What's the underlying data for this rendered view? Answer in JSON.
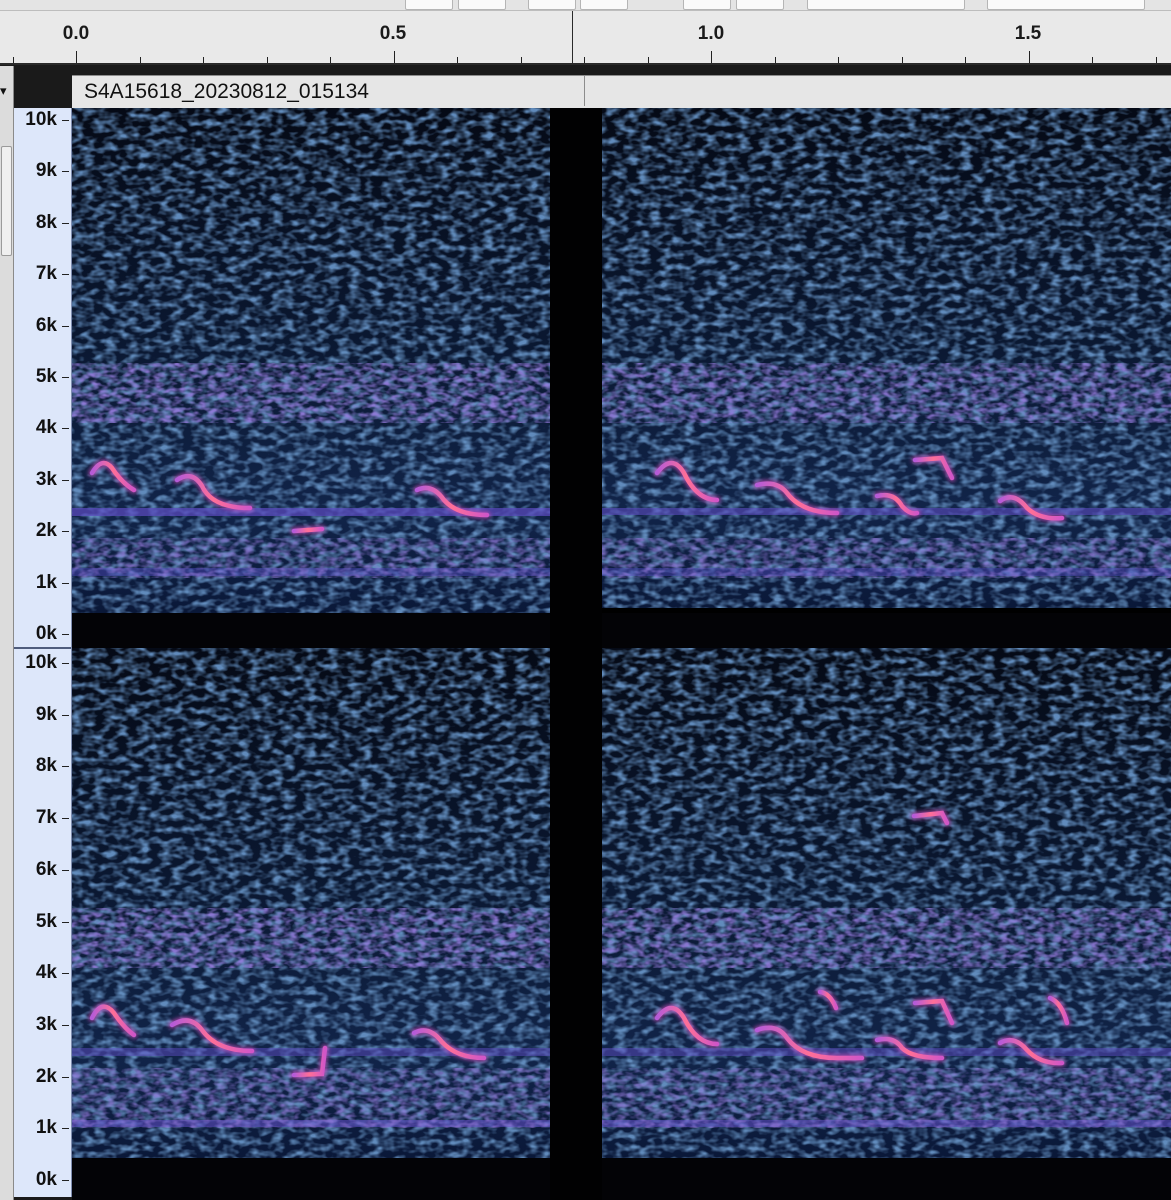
{
  "timeline": {
    "ticks": [
      {
        "label": "0.0",
        "value": 0.0
      },
      {
        "label": "0.5",
        "value": 0.5
      },
      {
        "label": "1.0",
        "value": 1.0
      },
      {
        "label": "1.5",
        "value": 1.5
      }
    ]
  },
  "track": {
    "name": "S4A15618_20230812_015134",
    "menu_arrow": "▾"
  },
  "freq_axis": {
    "labels": [
      "10k",
      "9k",
      "8k",
      "7k",
      "6k",
      "5k",
      "4k",
      "3k",
      "2k",
      "1k",
      "0k"
    ]
  },
  "colors": {
    "ruler_bg": "#e9e9e9",
    "freq_ruler_bg": "#dde7fa",
    "spectrogram_low": "#000000",
    "spectrogram_mid": "#1f3f6e",
    "band": "#4f3aa8",
    "call_hot": "#ff6b9a"
  },
  "icons": [
    "track-menu-arrow-icon"
  ]
}
